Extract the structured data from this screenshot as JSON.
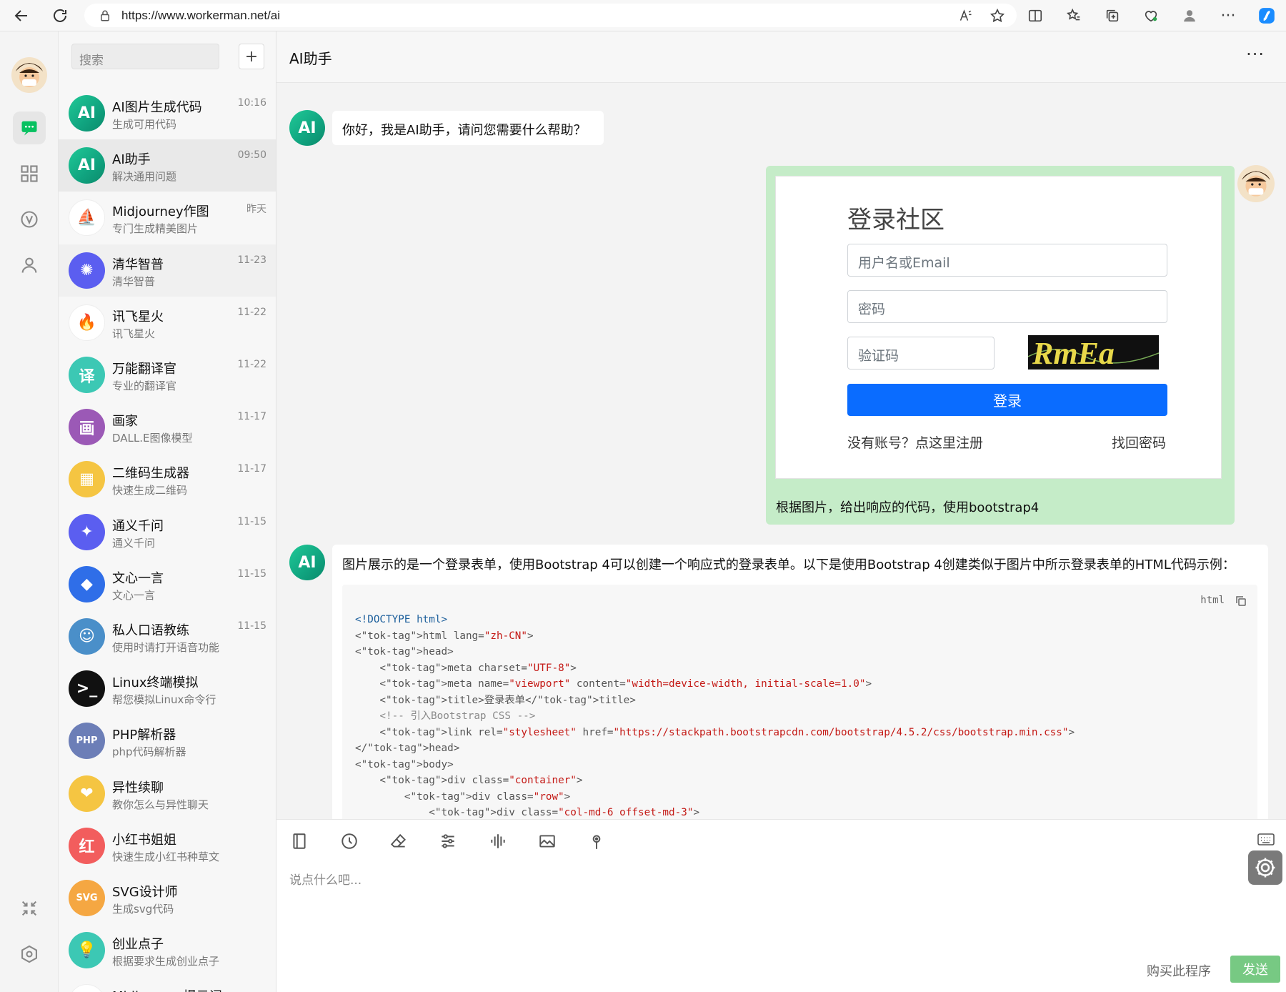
{
  "browser": {
    "url": "https://www.workerman.net/ai"
  },
  "sidebar": {
    "search_placeholder": "搜索",
    "add_label": "+"
  },
  "conversations": [
    {
      "name": "AI图片生成代码",
      "sub": "生成可用代码",
      "time": "10:16",
      "avatar_text": "AI",
      "color": "#16a085"
    },
    {
      "name": "AI助手",
      "sub": "解决通用问题",
      "time": "09:50",
      "avatar_text": "AI",
      "color": "#16a085"
    },
    {
      "name": "Midjourney作图",
      "sub": "专门生成精美图片",
      "time": "昨天",
      "avatar_text": "⛵",
      "color": "#ffffff"
    },
    {
      "name": "清华智普",
      "sub": "清华智普",
      "time": "11-23",
      "avatar_text": "✺",
      "color": "#5b5ef0"
    },
    {
      "name": "讯飞星火",
      "sub": "讯飞星火",
      "time": "11-22",
      "avatar_text": "🔥",
      "color": "#ffffff"
    },
    {
      "name": "万能翻译官",
      "sub": "专业的翻译官",
      "time": "11-22",
      "avatar_text": "译",
      "color": "#3cc8b4"
    },
    {
      "name": "画家",
      "sub": "DALL.E图像模型",
      "time": "11-17",
      "avatar_text": "画",
      "color": "#9b59b6"
    },
    {
      "name": "二维码生成器",
      "sub": "快速生成二维码",
      "time": "11-17",
      "avatar_text": "▦",
      "color": "#f5c542"
    },
    {
      "name": "通义千问",
      "sub": "通义千问",
      "time": "11-15",
      "avatar_text": "✦",
      "color": "#5b5ef0"
    },
    {
      "name": "文心一言",
      "sub": "文心一言",
      "time": "11-15",
      "avatar_text": "◆",
      "color": "#2f6ee8"
    },
    {
      "name": "私人口语教练",
      "sub": "使用时请打开语音功能",
      "time": "11-15",
      "avatar_text": "☺",
      "color": "#4a8fc9"
    },
    {
      "name": "Linux终端模拟",
      "sub": "帮您模拟Linux命令行",
      "time": "",
      "avatar_text": ">_",
      "color": "#111111"
    },
    {
      "name": "PHP解析器",
      "sub": "php代码解析器",
      "time": "",
      "avatar_text": "PHP",
      "color": "#6c7eb7"
    },
    {
      "name": "异性续聊",
      "sub": "教你怎么与异性聊天",
      "time": "",
      "avatar_text": "❤",
      "color": "#f5c542"
    },
    {
      "name": "小红书姐姐",
      "sub": "快速生成小红书种草文",
      "time": "",
      "avatar_text": "红",
      "color": "#f25d5d"
    },
    {
      "name": "SVG设计师",
      "sub": "生成svg代码",
      "time": "",
      "avatar_text": "SVG",
      "color": "#f5a742"
    },
    {
      "name": "创业点子",
      "sub": "根据要求生成创业点子",
      "time": "",
      "avatar_text": "💡",
      "color": "#3cc8b4"
    },
    {
      "name": "Midjourney提示词",
      "sub": "",
      "time": "",
      "avatar_text": "⛵",
      "color": "#ffffff"
    }
  ],
  "chat": {
    "title": "AI助手",
    "more_label": "···",
    "greeting": "你好，我是AI助手，请问您需要什么帮助？",
    "user_image": {
      "title": "登录社区",
      "username_placeholder": "用户名或Email",
      "password_placeholder": "密码",
      "captcha_placeholder": "验证码",
      "captcha_text": "RmEa",
      "login_label": "登录",
      "register_label": "没有账号？点这里注册",
      "forgot_label": "找回密码"
    },
    "user_caption": "根据图片，给出响应的代码，使用bootstrap4",
    "answer_intro": "图片展示的是一个登录表单，使用Bootstrap 4可以创建一个响应式的登录表单。以下是使用Bootstrap 4创建类似于图片中所示登录表单的HTML代码示例：",
    "code_lang": "html",
    "code_lines": [
      "<!DOCTYPE html>",
      "<html lang=\"zh-CN\">",
      "<head>",
      "    <meta charset=\"UTF-8\">",
      "    <meta name=\"viewport\" content=\"width=device-width, initial-scale=1.0\">",
      "    <title>登录表单</title>",
      "    <!-- 引入Bootstrap CSS -->",
      "    <link rel=\"stylesheet\" href=\"https://stackpath.bootstrapcdn.com/bootstrap/4.5.2/css/bootstrap.min.css\">",
      "</head>",
      "<body>",
      "    <div class=\"container\">",
      "        <div class=\"row\">",
      "            <div class=\"col-md-6 offset-md-3\">"
    ]
  },
  "composer": {
    "placeholder": "说点什么吧...",
    "buy_label": "购买此程序",
    "send_label": "发送"
  },
  "colors": {
    "accent_green": "#07c160",
    "user_bubble": "#c5ecc8",
    "send_button": "#77c983",
    "login_button": "#0a6cff"
  }
}
